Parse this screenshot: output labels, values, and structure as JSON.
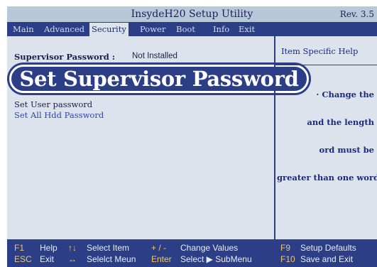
{
  "window": {
    "title": "InsydeH20 Setup Utility",
    "revision": "Rev. 3.5"
  },
  "menu": {
    "items": [
      {
        "label": "Main"
      },
      {
        "label": "Advanced"
      },
      {
        "label": "Security"
      },
      {
        "label": "Power"
      },
      {
        "label": "Boot"
      },
      {
        "label": "Info"
      },
      {
        "label": "Exit"
      }
    ],
    "selected": "Security"
  },
  "main": {
    "supervisor_password_label": "Supervisor Password :",
    "supervisor_password_value": "Not Installed",
    "callout": "Set Supervisor Password",
    "set_user_password": "Set User password",
    "set_all_hdd_password": "Set All Hdd Password"
  },
  "help": {
    "title": "Item Specific Help",
    "lines": [
      "· Change the",
      "and the length",
      "ord must be",
      "greater than one word."
    ]
  },
  "statusbar": {
    "row1": [
      {
        "key": "F1",
        "desc": "Help"
      },
      {
        "key": "↑↓",
        "desc": "Select Item"
      },
      {
        "key": "+ / -",
        "desc": "Change Values"
      },
      {
        "key": "F9",
        "desc": "Setup Defaults"
      }
    ],
    "row2": [
      {
        "key": "ESC",
        "desc": "Exit"
      },
      {
        "key": "↔",
        "desc": "Selelct Meun"
      },
      {
        "key": "Enter",
        "desc": "Select ▶ SubMenu"
      },
      {
        "key": "F10",
        "desc": "Save and Exit"
      }
    ]
  },
  "colors": {
    "menu_bar": "#2b3e86",
    "panel": "#dde3ec",
    "title_bar": "#b7c8d9",
    "key_text": "#f3c86a"
  }
}
